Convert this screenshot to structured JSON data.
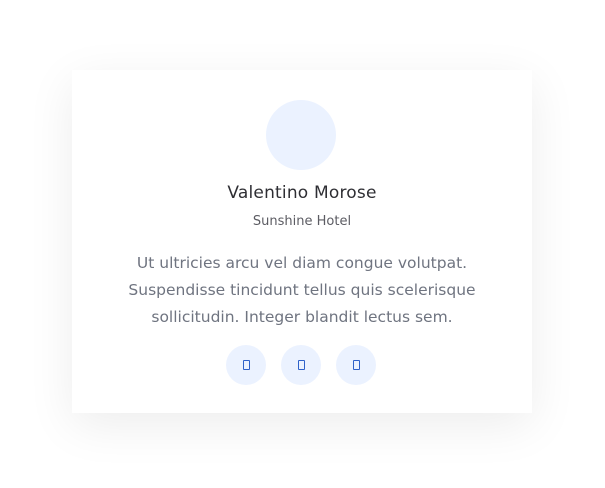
{
  "testimonial": {
    "name": "Valentino Morose",
    "company": "Sunshine Hotel",
    "quote_lines": [
      "Ut ultricies arcu vel diam congue volutpat.",
      "Suspendisse tincidunt tellus quis scelerisque",
      "sollicitudin. Integer blandit lectus sem."
    ],
    "avatar": "avatar-placeholder",
    "social_links": [
      {
        "icon": "social-icon"
      },
      {
        "icon": "social-icon"
      },
      {
        "icon": "social-icon"
      }
    ]
  },
  "colors": {
    "avatar_bg": "#ebf2ff",
    "social_bg": "#ebf2ff",
    "social_icon": "#2f62c9"
  }
}
